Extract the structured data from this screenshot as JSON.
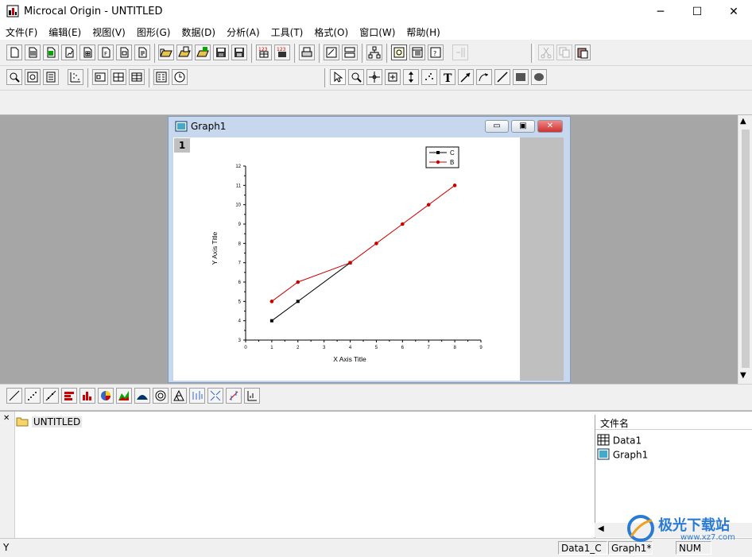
{
  "window": {
    "title": "Microcal Origin - UNTITLED",
    "icon": "origin-app-icon",
    "controls": {
      "minimize": "─",
      "maximize": "☐",
      "close": "✕"
    }
  },
  "menu": [
    "文件(F)",
    "编辑(E)",
    "视图(V)",
    "图形(G)",
    "数据(D)",
    "分析(A)",
    "工具(T)",
    "格式(O)",
    "窗口(W)",
    "帮助(H)"
  ],
  "graph_window": {
    "title": "Graph1",
    "layer_label": "1",
    "controls": {
      "minimize": "▭",
      "restore": "▣",
      "close": "✕"
    }
  },
  "chart_data": {
    "type": "line",
    "xlabel": "X Axis Title",
    "ylabel": "Y Axis Title",
    "xlim": [
      0,
      9
    ],
    "ylim": [
      3,
      12
    ],
    "xticks": [
      "0",
      "1",
      "2",
      "3",
      "4",
      "5",
      "6",
      "7",
      "8",
      "9"
    ],
    "yticks": [
      "3",
      "4",
      "5",
      "6",
      "7",
      "8",
      "9",
      "10",
      "11",
      "12"
    ],
    "legend_position": "top-right",
    "series": [
      {
        "name": "C",
        "color": "#000000",
        "marker": "square",
        "x": [
          1,
          2,
          4
        ],
        "y": [
          4,
          5,
          7
        ]
      },
      {
        "name": "B",
        "color": "#cc0000",
        "marker": "circle",
        "x": [
          1,
          2,
          4,
          5,
          6,
          7,
          8
        ],
        "y": [
          5,
          6,
          7,
          8,
          9,
          10,
          11
        ]
      }
    ]
  },
  "project_explorer": {
    "folder": "UNTITLED",
    "files_header": "文件名",
    "files": [
      {
        "name": "Data1",
        "icon": "worksheet-icon"
      },
      {
        "name": "Graph1",
        "icon": "graph-icon"
      }
    ]
  },
  "status_bar": {
    "left": "Y",
    "panels": [
      "Data1_C",
      "Graph1*",
      "NUM"
    ]
  },
  "watermark": {
    "text": "极光下载站",
    "url": "www.xz7.com"
  }
}
